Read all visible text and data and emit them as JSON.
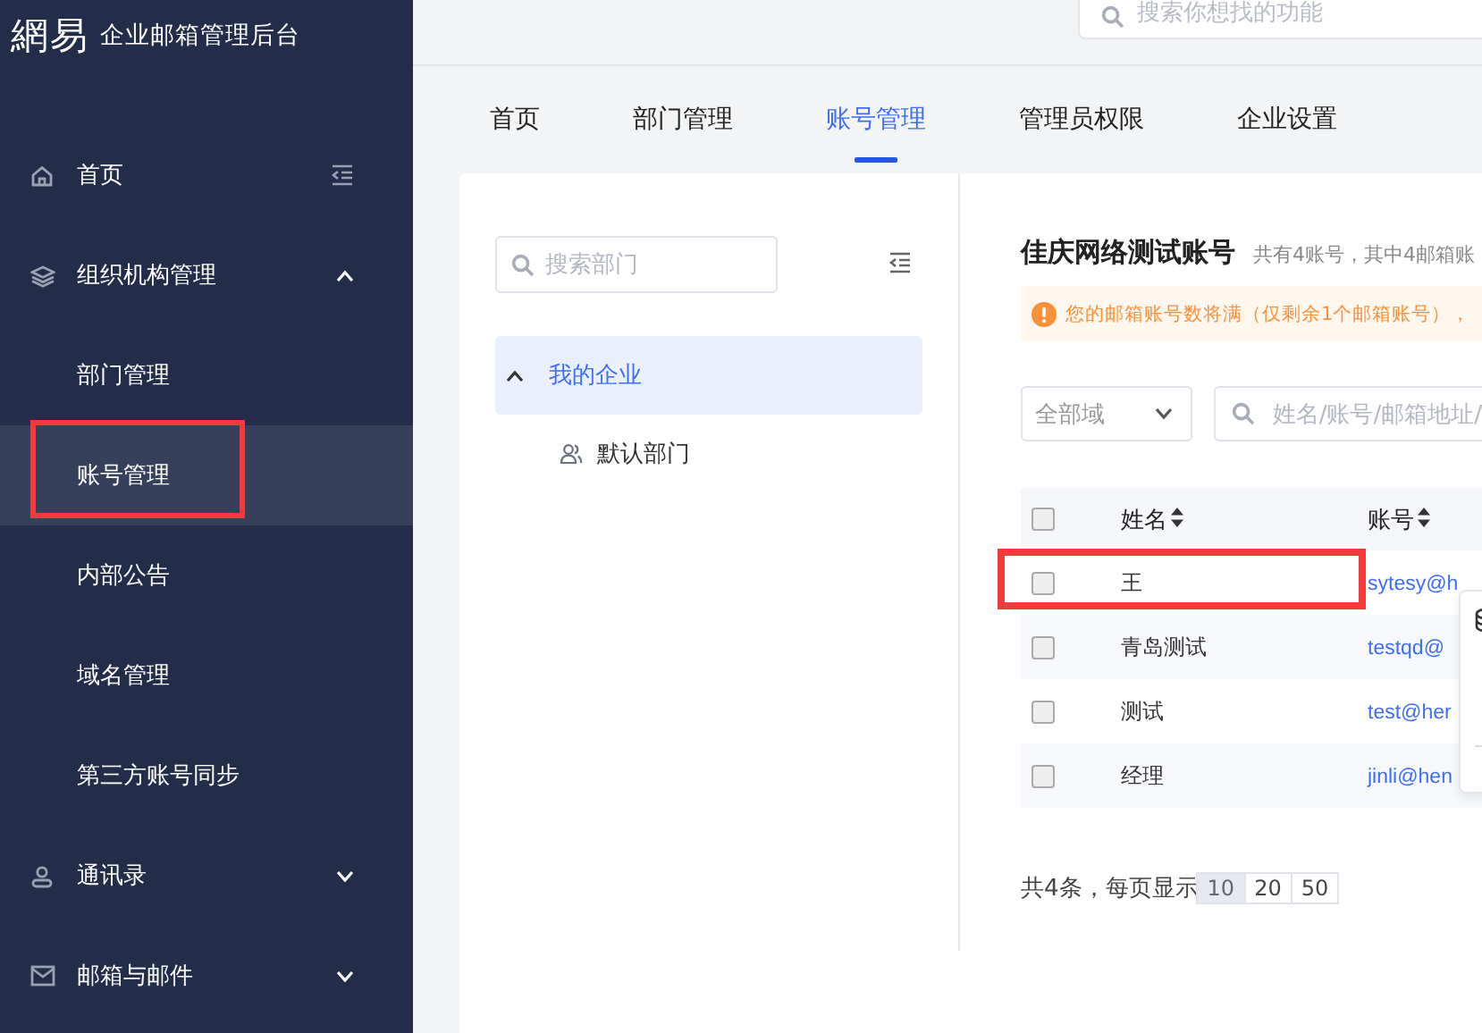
{
  "logo": {
    "mark": "網易",
    "title": "企业邮箱管理后台"
  },
  "sidebar": {
    "items": [
      {
        "label": "首页",
        "selected": false,
        "highlighted": false
      },
      {
        "label": "组织机构管理",
        "selected": false,
        "highlighted": false,
        "expanded": true,
        "children": [
          {
            "label": "部门管理",
            "selected": false,
            "highlighted": false
          },
          {
            "label": "账号管理",
            "selected": true,
            "highlighted": true
          },
          {
            "label": "内部公告",
            "selected": false,
            "highlighted": false
          },
          {
            "label": "域名管理",
            "selected": false,
            "highlighted": false
          },
          {
            "label": "第三方账号同步",
            "selected": false,
            "highlighted": false
          }
        ]
      },
      {
        "label": "通讯录",
        "selected": false,
        "highlighted": false,
        "expanded": false
      },
      {
        "label": "邮箱与邮件",
        "selected": false,
        "highlighted": false,
        "expanded": false
      }
    ]
  },
  "top_search": {
    "placeholder": "搜索你想找的功能"
  },
  "tabs": [
    {
      "label": "首页",
      "selected": false
    },
    {
      "label": "部门管理",
      "selected": false
    },
    {
      "label": "账号管理",
      "selected": true
    },
    {
      "label": "管理员权限",
      "selected": false
    },
    {
      "label": "企业设置",
      "selected": false
    }
  ],
  "departments": {
    "search": {
      "placeholder": "搜索部门"
    },
    "tree": [
      {
        "label": "我的企业",
        "selected": true,
        "expanded": true,
        "children": [
          {
            "label": "默认部门",
            "selected": false
          }
        ]
      }
    ]
  },
  "accounts": {
    "title": "佳庆网络测试账号",
    "summary": "共有4账号，其中4邮箱账",
    "alert": "您的邮箱账号数将满（仅剩余1个邮箱账号），",
    "domain_select": {
      "value": "全部域"
    },
    "search": {
      "placeholder": "姓名/账号/邮箱地址/"
    },
    "table": {
      "columns": [
        "姓名",
        "账号"
      ],
      "header_checked": false,
      "rows": [
        {
          "name": "王",
          "account": "sytesy@h",
          "checked": false,
          "highlighted": true
        },
        {
          "name": "青岛测试",
          "account": "testqd@",
          "checked": false,
          "highlighted": false
        },
        {
          "name": "测试",
          "account": "test@her",
          "checked": false,
          "highlighted": false
        },
        {
          "name": "经理",
          "account": "jinli@hen",
          "checked": false,
          "highlighted": false
        }
      ]
    },
    "pagination": {
      "total": "共4条，每页显示",
      "sizes": [
        {
          "label": "10",
          "selected": true
        },
        {
          "label": "20",
          "selected": false
        },
        {
          "label": "50",
          "selected": false
        }
      ]
    }
  }
}
